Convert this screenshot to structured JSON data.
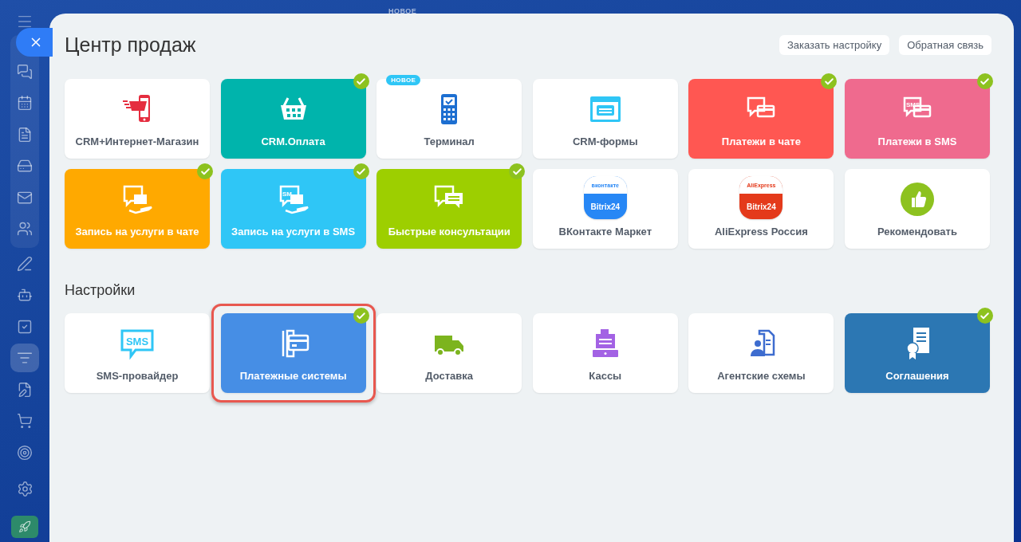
{
  "sidebar": {
    "items": [
      {
        "selected": false
      },
      {
        "selected": false
      },
      {
        "selected": false
      },
      {
        "selected": false
      },
      {
        "selected": false
      },
      {
        "selected": false
      },
      {
        "selected": false
      },
      {
        "selected": false
      },
      {
        "selected": false
      },
      {
        "selected": true
      },
      {
        "selected": false
      },
      {
        "selected": false
      },
      {
        "selected": false
      },
      {
        "selected": false
      },
      {
        "selected": false
      }
    ]
  },
  "backdrop_label": "НОВОЕ",
  "title": "Центр продаж",
  "header_buttons": [
    "Заказать настройку",
    "Обратная связь"
  ],
  "sections": [
    {
      "tiles": [
        {
          "label": "CRM+Интернет-Магазин",
          "color": "#ffffff",
          "checked": false,
          "highlighted": false
        },
        {
          "label": "CRM.Оплата",
          "color": "#00b4ac",
          "checked": true,
          "highlighted": false
        },
        {
          "label": "Терминал",
          "color": "#ffffff",
          "checked": false,
          "highlighted": false,
          "badge": "НОВОЕ"
        },
        {
          "label": "CRM-формы",
          "color": "#ffffff",
          "checked": false,
          "highlighted": false
        },
        {
          "label": "Платежи в чате",
          "color": "#ff5752",
          "checked": true,
          "highlighted": false
        },
        {
          "label": "Платежи в SMS",
          "color": "#ef6a8e",
          "checked": true,
          "highlighted": false,
          "icon_text": "SMS"
        },
        {
          "label": "Запись на услуги в чате",
          "color": "#ffa900",
          "checked": true,
          "highlighted": false
        },
        {
          "label": "Запись на услуги в SMS",
          "color": "#2fc6f6",
          "checked": true,
          "highlighted": false,
          "icon_text": "SM"
        },
        {
          "label": "Быстрые консультации",
          "color": "#9dcf00",
          "checked": true,
          "highlighted": false
        },
        {
          "label": "ВКонтакте Маркет",
          "color": "#ffffff",
          "checked": false,
          "highlighted": false,
          "logo": {
            "top": "вконтакте",
            "bottom": "Bitrix24"
          }
        },
        {
          "label": "AliExpress Россия",
          "color": "#ffffff",
          "checked": false,
          "highlighted": false,
          "logo": {
            "top": "AliExpress",
            "bottom": "Bitrix24"
          }
        },
        {
          "label": "Рекомендовать",
          "color": "#ffffff",
          "checked": false,
          "highlighted": false
        }
      ]
    },
    {
      "title": "Настройки",
      "tiles": [
        {
          "label": "SMS-провайдер",
          "color": "#ffffff",
          "checked": false,
          "highlighted": false,
          "icon_text": "SMS"
        },
        {
          "label": "Платежные системы",
          "color": "#468ee5",
          "checked": true,
          "highlighted": true
        },
        {
          "label": "Доставка",
          "color": "#ffffff",
          "checked": false,
          "highlighted": false
        },
        {
          "label": "Кассы",
          "color": "#ffffff",
          "checked": false,
          "highlighted": false
        },
        {
          "label": "Агентские схемы",
          "color": "#ffffff",
          "checked": false,
          "highlighted": false
        },
        {
          "label": "Соглашения",
          "color": "#2c77b3",
          "checked": true,
          "highlighted": false
        }
      ]
    }
  ]
}
